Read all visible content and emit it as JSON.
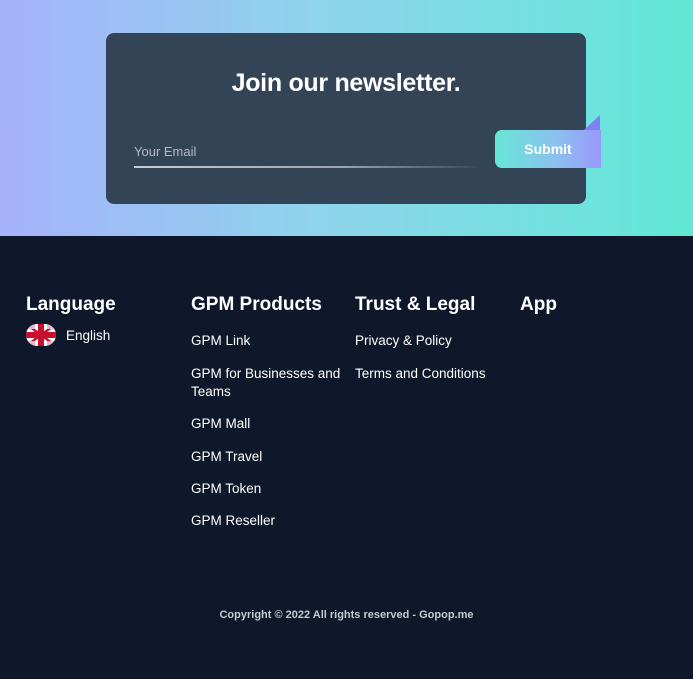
{
  "newsletter": {
    "title": "Join our newsletter.",
    "email_placeholder": "Your Email",
    "submit_label": "Submit"
  },
  "footer": {
    "language": {
      "heading": "Language",
      "selected": "English",
      "flag_icon": "uk-flag-icon"
    },
    "products": {
      "heading": "GPM Products",
      "links": [
        "GPM Link",
        "GPM for Businesses and Teams",
        "GPM Mall",
        "GPM Travel",
        "GPM Token",
        "GPM Reseller"
      ]
    },
    "legal": {
      "heading": "Trust & Legal",
      "links": [
        "Privacy & Policy",
        "Terms and Conditions"
      ]
    },
    "app": {
      "heading": "App"
    },
    "copyright": "Copyright © 2022 All rights reserved - Gopop.me"
  },
  "colors": {
    "footer_bg": "#0f172a",
    "card_bg": "#344457",
    "gradient_left": "#a6b2fb",
    "gradient_right": "#62e8d6"
  }
}
